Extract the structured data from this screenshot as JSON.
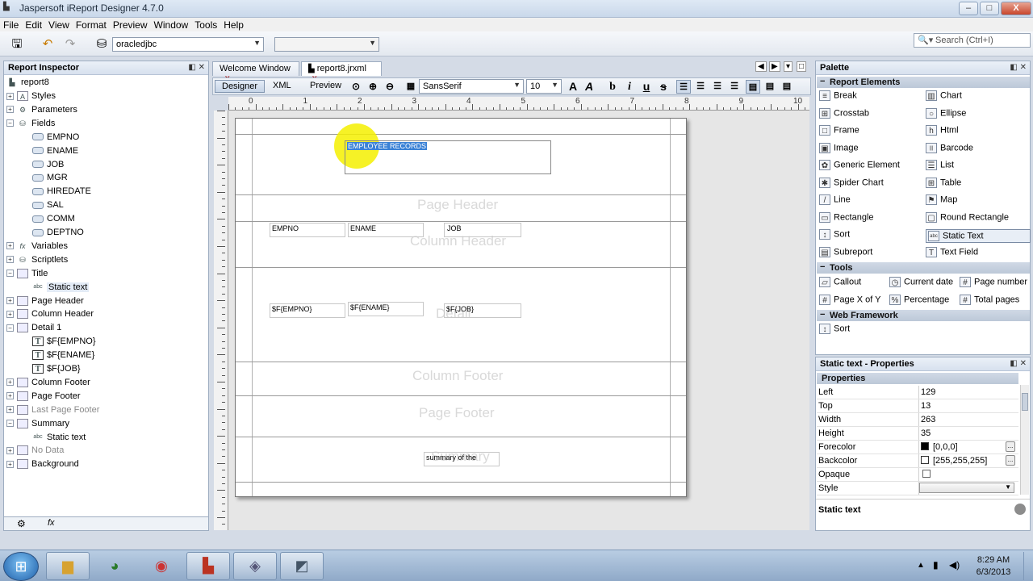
{
  "window": {
    "title": "Jaspersoft iReport Designer 4.7.0",
    "controls": {
      "minimize": "–",
      "maximize": "□",
      "close": "X"
    }
  },
  "menu": [
    "File",
    "Edit",
    "View",
    "Format",
    "Preview",
    "Window",
    "Tools",
    "Help"
  ],
  "toolbar": {
    "datasource": "oracledjbc",
    "second_combo": "",
    "search_placeholder": "Search (Ctrl+I)"
  },
  "inspector": {
    "title": "Report Inspector",
    "root": "report8",
    "items": [
      {
        "label": "Styles",
        "level": 0,
        "exp": "+",
        "icon": "A"
      },
      {
        "label": "Parameters",
        "level": 0,
        "exp": "+",
        "icon": "P"
      },
      {
        "label": "Fields",
        "level": 0,
        "exp": "−",
        "icon": "F"
      },
      {
        "label": "EMPNO",
        "level": 1,
        "icon": "field"
      },
      {
        "label": "ENAME",
        "level": 1,
        "icon": "field"
      },
      {
        "label": "JOB",
        "level": 1,
        "icon": "field"
      },
      {
        "label": "MGR",
        "level": 1,
        "icon": "field"
      },
      {
        "label": "HIREDATE",
        "level": 1,
        "icon": "field"
      },
      {
        "label": "SAL",
        "level": 1,
        "icon": "field"
      },
      {
        "label": "COMM",
        "level": 1,
        "icon": "field"
      },
      {
        "label": "DEPTNO",
        "level": 1,
        "icon": "field"
      },
      {
        "label": "Variables",
        "level": 0,
        "exp": "+",
        "icon": "fx"
      },
      {
        "label": "Scriptlets",
        "level": 0,
        "exp": "+",
        "icon": "S"
      },
      {
        "label": "Title",
        "level": 0,
        "exp": "−",
        "icon": "band"
      },
      {
        "label": "Static text",
        "level": 1,
        "icon": "abc",
        "selected": true
      },
      {
        "label": "Page Header",
        "level": 0,
        "exp": "+",
        "icon": "band"
      },
      {
        "label": "Column Header",
        "level": 0,
        "exp": "+",
        "icon": "band"
      },
      {
        "label": "Detail 1",
        "level": 0,
        "exp": "−",
        "icon": "band"
      },
      {
        "label": "$F{EMPNO}",
        "level": 1,
        "icon": "T"
      },
      {
        "label": "$F{ENAME}",
        "level": 1,
        "icon": "T"
      },
      {
        "label": "$F{JOB}",
        "level": 1,
        "icon": "T"
      },
      {
        "label": "Column Footer",
        "level": 0,
        "exp": "+",
        "icon": "band"
      },
      {
        "label": "Page Footer",
        "level": 0,
        "exp": "+",
        "icon": "band"
      },
      {
        "label": "Last Page Footer",
        "level": 0,
        "exp": "+",
        "icon": "band",
        "dim": true
      },
      {
        "label": "Summary",
        "level": 0,
        "exp": "−",
        "icon": "band"
      },
      {
        "label": "Static text",
        "level": 1,
        "icon": "abc"
      },
      {
        "label": "No Data",
        "level": 0,
        "exp": "+",
        "icon": "band",
        "dim": true
      },
      {
        "label": "Background",
        "level": 0,
        "exp": "+",
        "icon": "band"
      }
    ]
  },
  "editor": {
    "tabs": [
      {
        "label": "Welcome Window",
        "active": false
      },
      {
        "label": "report8.jrxml",
        "active": true
      }
    ],
    "modes": [
      "Designer",
      "XML",
      "Preview"
    ],
    "font_name": "SansSerif",
    "font_size": "10",
    "ruler_numbers": [
      "0",
      "1",
      "2",
      "3",
      "4",
      "5",
      "6",
      "7",
      "8",
      "9",
      "10"
    ]
  },
  "report": {
    "title_text": "EMPLOYEE RECORDS",
    "bands": [
      "Page Header",
      "Column Header",
      "Detail",
      "Column Footer",
      "Page Footer",
      "Summary"
    ],
    "column_headers": [
      "EMPNO",
      "ENAME",
      "JOB"
    ],
    "detail_fields": [
      "$F{EMPNO}",
      "$F{ENAME}",
      "$F{JOB}"
    ],
    "summary_text": "summary of the"
  },
  "palette": {
    "title": "Palette",
    "report_elements_label": "Report Elements",
    "report_elements": [
      {
        "label": "Break",
        "icon": "≡"
      },
      {
        "label": "Chart",
        "icon": "▥"
      },
      {
        "label": "Crosstab",
        "icon": "⊞"
      },
      {
        "label": "Ellipse",
        "icon": "○"
      },
      {
        "label": "Frame",
        "icon": "□"
      },
      {
        "label": "Html",
        "icon": "h"
      },
      {
        "label": "Image",
        "icon": "▣"
      },
      {
        "label": "Barcode",
        "icon": "|||"
      },
      {
        "label": "Generic Element",
        "icon": "✿"
      },
      {
        "label": "List",
        "icon": "☰"
      },
      {
        "label": "Spider Chart",
        "icon": "✱"
      },
      {
        "label": "Table",
        "icon": "⊞"
      },
      {
        "label": "Line",
        "icon": "/"
      },
      {
        "label": "Map",
        "icon": "⚑"
      },
      {
        "label": "Rectangle",
        "icon": "▭"
      },
      {
        "label": "Round Rectangle",
        "icon": "▢"
      },
      {
        "label": "Sort",
        "icon": "↕"
      },
      {
        "label": "Static Text",
        "icon": "abc",
        "selected": true
      },
      {
        "label": "Subreport",
        "icon": "▤"
      },
      {
        "label": "Text Field",
        "icon": "T"
      }
    ],
    "tools_label": "Tools",
    "tools": [
      {
        "label": "Callout",
        "icon": "▱"
      },
      {
        "label": "Current date",
        "icon": "◷"
      },
      {
        "label": "Page number",
        "icon": "#"
      },
      {
        "label": "Page X of Y",
        "icon": "#"
      },
      {
        "label": "Percentage",
        "icon": "%"
      },
      {
        "label": "Total pages",
        "icon": "#"
      }
    ],
    "web_label": "Web Framework",
    "web": [
      {
        "label": "Sort",
        "icon": "↕"
      }
    ]
  },
  "properties": {
    "title": "Static text - Properties",
    "section": "Properties",
    "rows": [
      {
        "key": "Left",
        "value": "129"
      },
      {
        "key": "Top",
        "value": "13"
      },
      {
        "key": "Width",
        "value": "263"
      },
      {
        "key": "Height",
        "value": "35"
      },
      {
        "key": "Forecolor",
        "value": "[0,0,0]",
        "swatch": "#000000"
      },
      {
        "key": "Backcolor",
        "value": "[255,255,255]",
        "swatch": "#ffffff"
      },
      {
        "key": "Opaque",
        "value": ""
      },
      {
        "key": "Style",
        "value": ""
      }
    ],
    "footer": "Static text"
  },
  "taskbar": {
    "time": "8:29 AM",
    "date": "6/3/2013"
  }
}
